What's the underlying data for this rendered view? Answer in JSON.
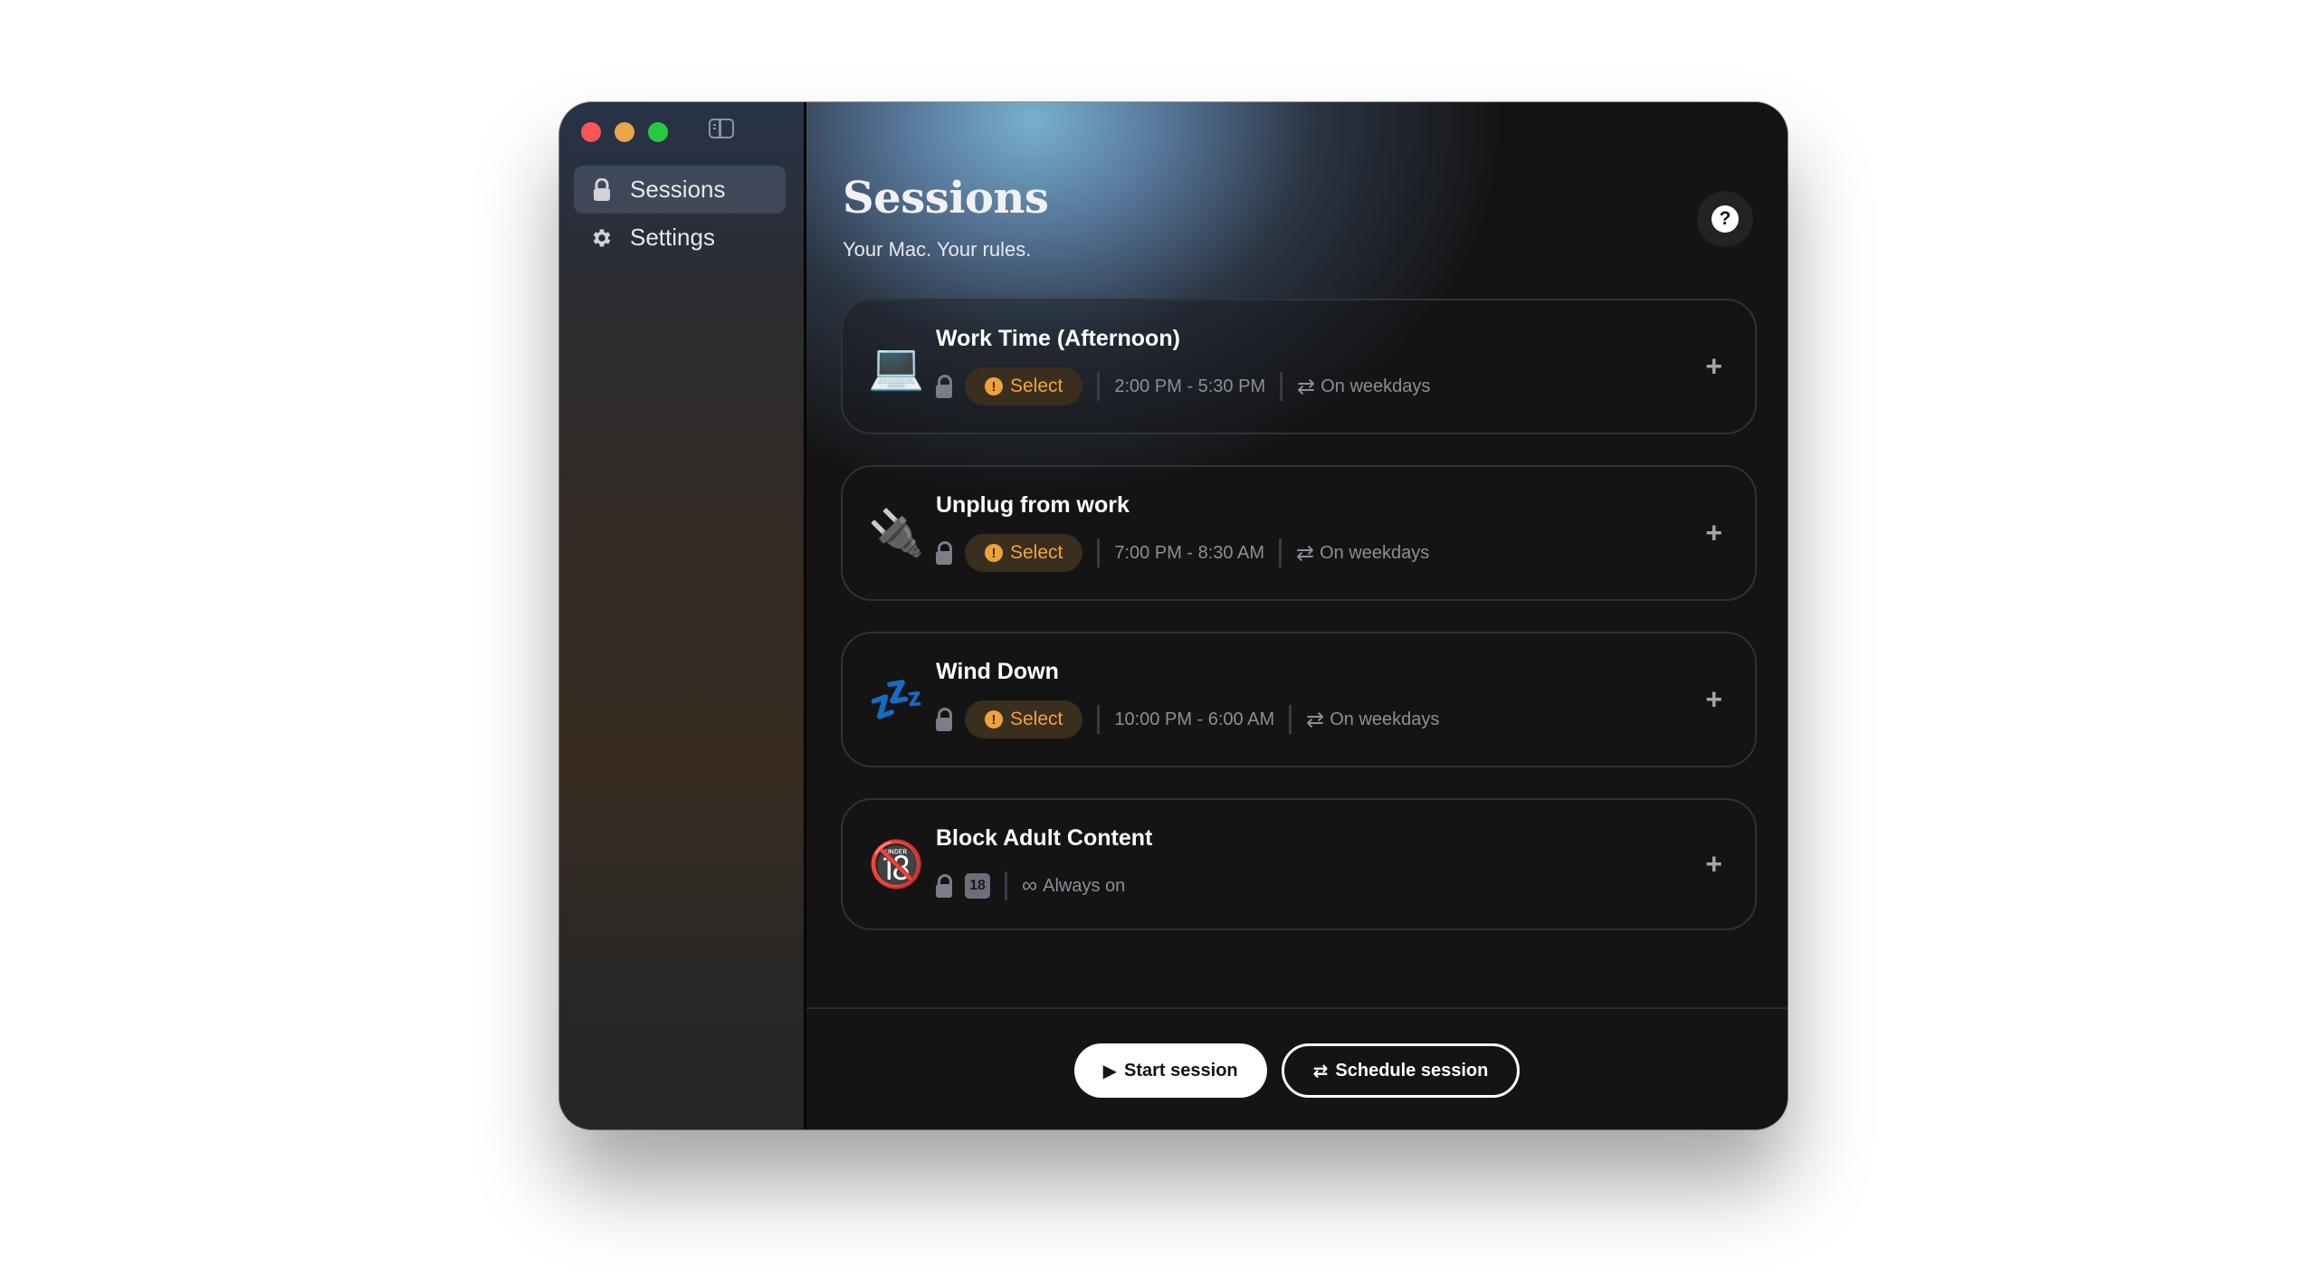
{
  "window": {
    "traffic_lights": [
      "close",
      "minimize",
      "zoom"
    ]
  },
  "sidebar": {
    "toggle_icon": "sidebar-toggle-icon",
    "items": [
      {
        "label": "Sessions",
        "icon": "lock-icon",
        "active": true
      },
      {
        "label": "Settings",
        "icon": "gear-icon",
        "active": false
      }
    ]
  },
  "header": {
    "title": "Sessions",
    "subtitle": "Your Mac. Your rules.",
    "help_label": "?"
  },
  "sessions": [
    {
      "emoji": "💻",
      "icon": "laptop-icon",
      "title": "Work Time (Afternoon)",
      "pill": "Select",
      "time": "2:00 PM - 5:30 PM",
      "repeat": "On weekdays"
    },
    {
      "emoji": "🔌",
      "icon": "plug-icon",
      "title": "Unplug from work",
      "pill": "Select",
      "time": "7:00 PM - 8:30 AM",
      "repeat": "On weekdays"
    },
    {
      "emoji": "💤",
      "icon": "zzz-icon",
      "title": "Wind Down",
      "pill": "Select",
      "time": "10:00 PM - 6:00 AM",
      "repeat": "On weekdays"
    },
    {
      "emoji": "🔞",
      "icon": "no-under-18-icon",
      "title": "Block Adult Content",
      "badge": "18",
      "repeat": "Always on"
    }
  ],
  "footer": {
    "start_label": "Start session",
    "schedule_label": "Schedule session"
  },
  "colors": {
    "accent_warning": "#f0a23a",
    "pill_bg": "#3a2e1f",
    "card_border": "#2f323a"
  }
}
